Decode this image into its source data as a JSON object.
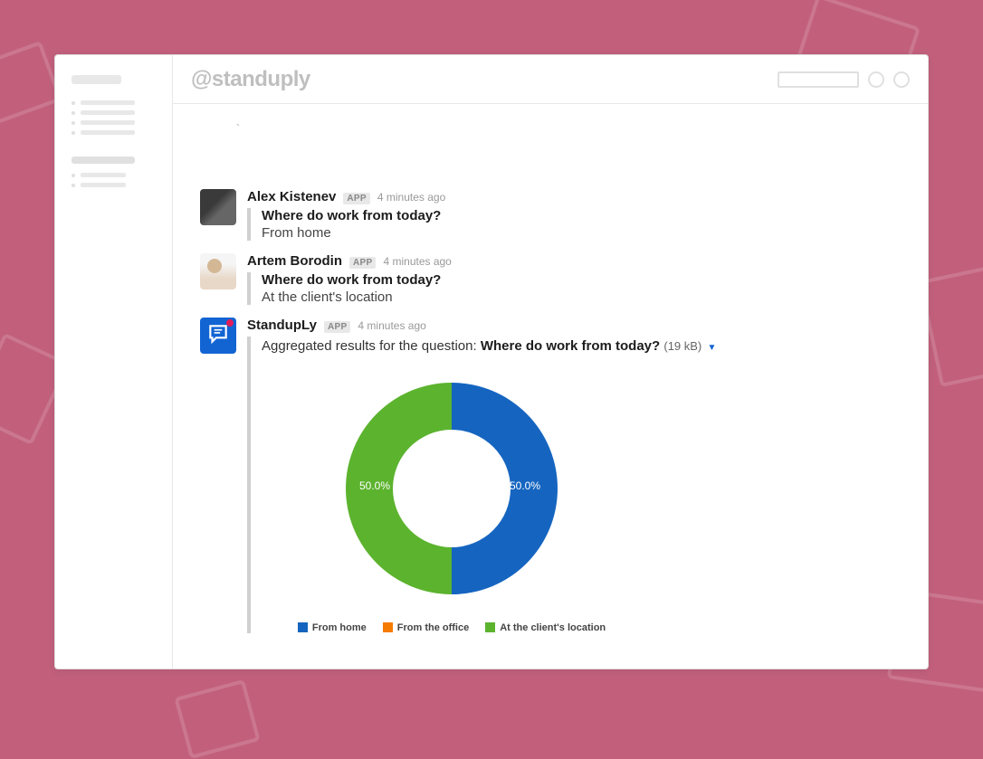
{
  "header": {
    "title": "@standuply"
  },
  "messages": [
    {
      "name": "Alex Kistenev",
      "badge": "APP",
      "time": "4 minutes ago",
      "question": "Where do work from today?",
      "answer": "From home"
    },
    {
      "name": "Artem Borodin",
      "badge": "APP",
      "time": "4 minutes ago",
      "question": "Where do work from today?",
      "answer": "At the client's location"
    }
  ],
  "bot_message": {
    "name": "StandupLy",
    "badge": "APP",
    "time": "4 minutes ago",
    "prefix": "Aggregated results for the question: ",
    "question": "Where do work from today?",
    "file_size": "(19 kB)"
  },
  "chart_data": {
    "type": "pie",
    "title": "",
    "series": [
      {
        "name": "From home",
        "value": 50.0,
        "color": "#1565C0",
        "label": "50.0%"
      },
      {
        "name": "From the office",
        "value": 0.0,
        "color": "#F57C00",
        "label": ""
      },
      {
        "name": "At the client's location",
        "value": 50.0,
        "color": "#5CB32E",
        "label": "50.0%"
      }
    ],
    "legend": [
      "From home",
      "From the office",
      "At the client's location"
    ]
  }
}
